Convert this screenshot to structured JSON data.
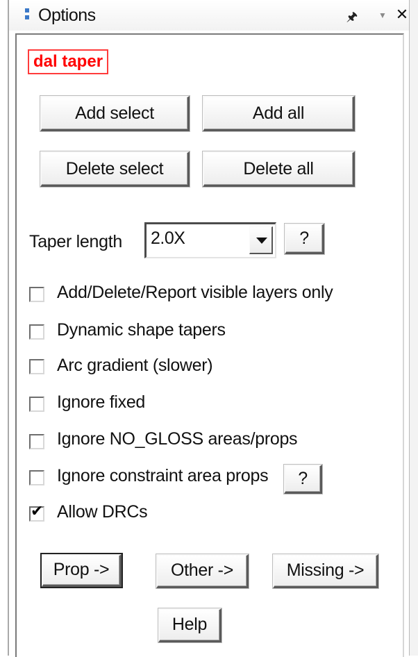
{
  "window": {
    "title": "Options"
  },
  "mode_label": "dal taper",
  "buttons": {
    "add_select": "Add select",
    "add_all": "Add all",
    "delete_select": "Delete select",
    "delete_all": "Delete all"
  },
  "taper_length": {
    "label": "Taper length",
    "value": "2.0X",
    "help": "?"
  },
  "options": [
    {
      "label": "Add/Delete/Report visible layers only",
      "checked": false
    },
    {
      "label": "Dynamic shape tapers",
      "checked": false
    },
    {
      "label": "Arc gradient (slower)",
      "checked": false
    },
    {
      "label": "Ignore fixed",
      "checked": false
    },
    {
      "label": "Ignore NO_GLOSS areas/props",
      "checked": false
    },
    {
      "label": "Ignore constraint area props",
      "checked": false
    },
    {
      "label": "Allow DRCs",
      "checked": true
    }
  ],
  "constraint_help": "?",
  "bottom_buttons": {
    "prop": "Prop ->",
    "other": "Other ->",
    "missing": "Missing ->",
    "help": "Help"
  },
  "colors": {
    "mode_label_text": "#ff0000",
    "mode_label_border": "#ff3b3b",
    "title_accent": "#3a78c8"
  },
  "icons": {
    "pin": "pin-icon",
    "dropdown": "dropdown-arrow-icon",
    "close": "close-icon"
  }
}
